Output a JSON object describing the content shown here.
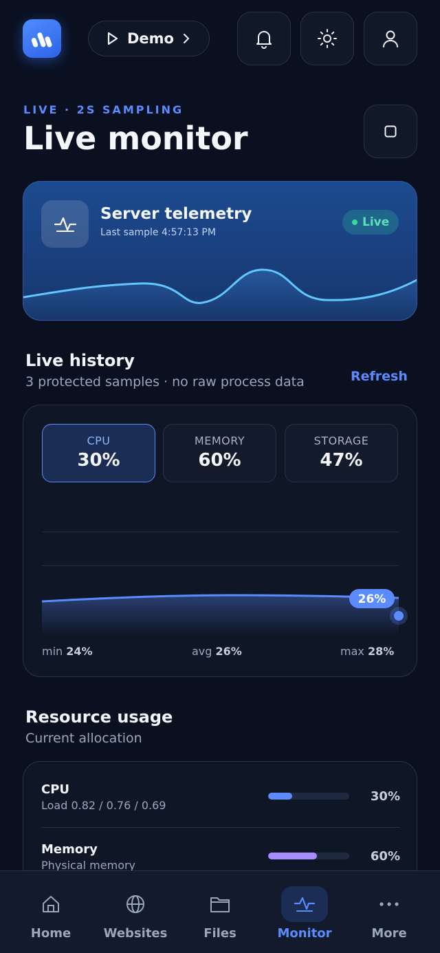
{
  "header": {
    "demo_label": "Demo"
  },
  "page": {
    "eyebrow": "LIVE · 2S SAMPLING",
    "title": "Live monitor"
  },
  "telemetry": {
    "title": "Server telemetry",
    "subtitle": "Last sample 4:57:13 PM",
    "status": "Live"
  },
  "history": {
    "title": "Live history",
    "subtitle": "3 protected samples · no raw process data",
    "refresh_label": "Refresh",
    "tabs": [
      {
        "label": "CPU",
        "value": "30%"
      },
      {
        "label": "MEMORY",
        "value": "60%"
      },
      {
        "label": "STORAGE",
        "value": "47%"
      }
    ],
    "current_label": "26%",
    "stats": {
      "min_label": "min",
      "min_value": "24%",
      "avg_label": "avg",
      "avg_value": "26%",
      "max_label": "max",
      "max_value": "28%"
    }
  },
  "resources": {
    "title": "Resource usage",
    "subtitle": "Current allocation",
    "items": [
      {
        "name": "CPU",
        "detail": "Load 0.82 / 0.76 / 0.69",
        "percent": "30%",
        "level": 0.3,
        "color": "#5b8cff"
      },
      {
        "name": "Memory",
        "detail": "Physical memory",
        "percent": "60%",
        "level": 0.6,
        "color": "#a78bfa"
      }
    ]
  },
  "nav": {
    "items": [
      {
        "label": "Home"
      },
      {
        "label": "Websites"
      },
      {
        "label": "Files"
      },
      {
        "label": "Monitor"
      },
      {
        "label": "More"
      }
    ]
  },
  "colors": {
    "accent": "#5b8cff",
    "live": "#3dd79b",
    "background": "#0a1020"
  }
}
